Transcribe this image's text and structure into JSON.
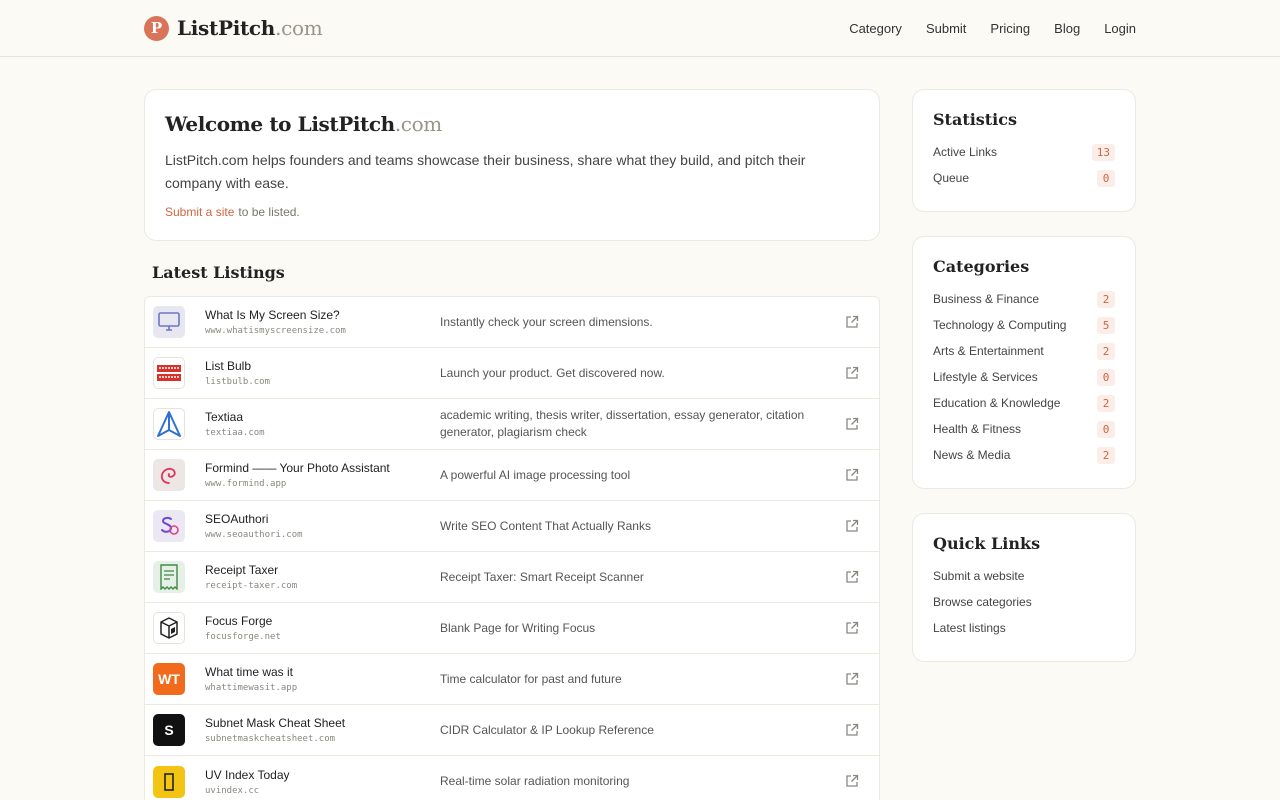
{
  "header": {
    "brand_logo_letter": "P",
    "brand_name": "ListPitch",
    "brand_tld": ".com",
    "nav": [
      "Category",
      "Submit",
      "Pricing",
      "Blog",
      "Login"
    ]
  },
  "welcome": {
    "title_name": "Welcome to ListPitch",
    "title_tld": ".com",
    "lead": "ListPitch.com helps founders and teams showcase their business, share what they build, and pitch their company with ease.",
    "submit_link": "Submit a site",
    "submit_suffix": "to be listed."
  },
  "listings": {
    "title": "Latest Listings",
    "items": [
      {
        "name": "What Is My Screen Size?",
        "domain": "www.whatismyscreensize.com",
        "desc": "Instantly check your screen dimensions.",
        "icon": "monitor-icon",
        "icon_bg": "#e8e7f0",
        "icon_fg": "#6a76c8"
      },
      {
        "name": "List Bulb",
        "domain": "listbulb.com",
        "desc": "Launch your product. Get discovered now.",
        "icon": "listbulb-logo-icon",
        "icon_bg": "#ffffff",
        "icon_fg": "#d6322c"
      },
      {
        "name": "Textiaa",
        "domain": "textiaa.com",
        "desc": "academic writing, thesis writer, dissertation, essay generator, citation generator, plagiarism check",
        "icon": "paper-plane-icon",
        "icon_bg": "#ffffff",
        "icon_fg": "#2f6fd6"
      },
      {
        "name": "Formind —— Your Photo Assistant",
        "domain": "www.formind.app",
        "desc": "A powerful AI image processing tool",
        "icon": "swirl-icon",
        "icon_bg": "#ece7e4",
        "icon_fg": "#e0355a"
      },
      {
        "name": "SEOAuthori",
        "domain": "www.seoauthori.com",
        "desc": "Write SEO Content That Actually Ranks",
        "icon": "seo-logo-icon",
        "icon_bg": "#ebe8f3",
        "icon_fg": "#6a4ad6"
      },
      {
        "name": "Receipt Taxer",
        "domain": "receipt-taxer.com",
        "desc": "Receipt Taxer: Smart Receipt Scanner",
        "icon": "receipt-icon",
        "icon_bg": "#e6f0e6",
        "icon_fg": "#3e8a4a"
      },
      {
        "name": "Focus Forge",
        "domain": "focusforge.net",
        "desc": "Blank Page for Writing Focus",
        "icon": "cube-icon",
        "icon_bg": "#ffffff",
        "icon_fg": "#222222"
      },
      {
        "name": "What time was it",
        "domain": "whattimewasit.app",
        "desc": "Time calculator for past and future",
        "icon": "wt-logo-icon",
        "icon_bg": "#f26b1d",
        "icon_fg": "#ffffff",
        "icon_text": "WT"
      },
      {
        "name": "Subnet Mask Cheat Sheet",
        "domain": "subnetmaskcheatsheet.com",
        "desc": "CIDR Calculator & IP Lookup Reference",
        "icon": "s-logo-icon",
        "icon_bg": "#111111",
        "icon_fg": "#ffffff",
        "icon_text": "S"
      },
      {
        "name": "UV Index Today",
        "domain": "uvindex.cc",
        "desc": "Real-time solar radiation monitoring",
        "icon": "uv-logo-icon",
        "icon_bg": "#f3c414",
        "icon_fg": "#222222"
      }
    ]
  },
  "statistics": {
    "title": "Statistics",
    "items": [
      {
        "label": "Active Links",
        "value": "13"
      },
      {
        "label": "Queue",
        "value": "0"
      }
    ]
  },
  "categories": {
    "title": "Categories",
    "items": [
      {
        "label": "Business & Finance",
        "value": "2"
      },
      {
        "label": "Technology & Computing",
        "value": "5"
      },
      {
        "label": "Arts & Entertainment",
        "value": "2"
      },
      {
        "label": "Lifestyle & Services",
        "value": "0"
      },
      {
        "label": "Education & Knowledge",
        "value": "2"
      },
      {
        "label": "Health & Fitness",
        "value": "0"
      },
      {
        "label": "News & Media",
        "value": "2"
      }
    ]
  },
  "quick_links": {
    "title": "Quick Links",
    "items": [
      "Submit a website",
      "Browse categories",
      "Latest listings"
    ]
  },
  "colors": {
    "accent": "#d0653f",
    "logo": "#d9735a",
    "background": "#fbfaf5"
  }
}
